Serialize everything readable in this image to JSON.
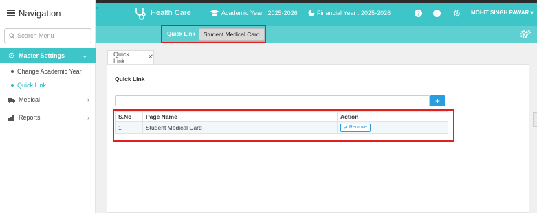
{
  "sidebar": {
    "title": "Navigation",
    "search_placeholder": "Search Menu",
    "master_label": "Master Settings",
    "sub_items": [
      {
        "label": "Change Academic Year"
      },
      {
        "label": "Quick Link"
      }
    ],
    "menu_items": [
      {
        "label": "Medical",
        "icon": "ambulance-icon"
      },
      {
        "label": "Reports",
        "icon": "bar-chart-icon"
      }
    ]
  },
  "header": {
    "brand": "Health Care",
    "academic_year": "Academic Year : 2025-2026",
    "financial_year": "Financial Year : 2025-2026",
    "user_name": "MOHIT SINGH PAWAR",
    "colors": {
      "primary": "#3ec5c8",
      "highlight": "#e02020",
      "accent_blue": "#2a9de0"
    }
  },
  "quickbar": {
    "label": "Quick Link",
    "button": "Student Medical Card"
  },
  "tab": {
    "label": "Quick Link",
    "close": "✕"
  },
  "panel": {
    "title": "Quick Link",
    "add_label": "+"
  },
  "table": {
    "headers": [
      "S.No",
      "Page Name",
      "Action"
    ],
    "rows": [
      {
        "sno": "1",
        "page": "Student Medical Card",
        "action": "Remove"
      }
    ]
  }
}
